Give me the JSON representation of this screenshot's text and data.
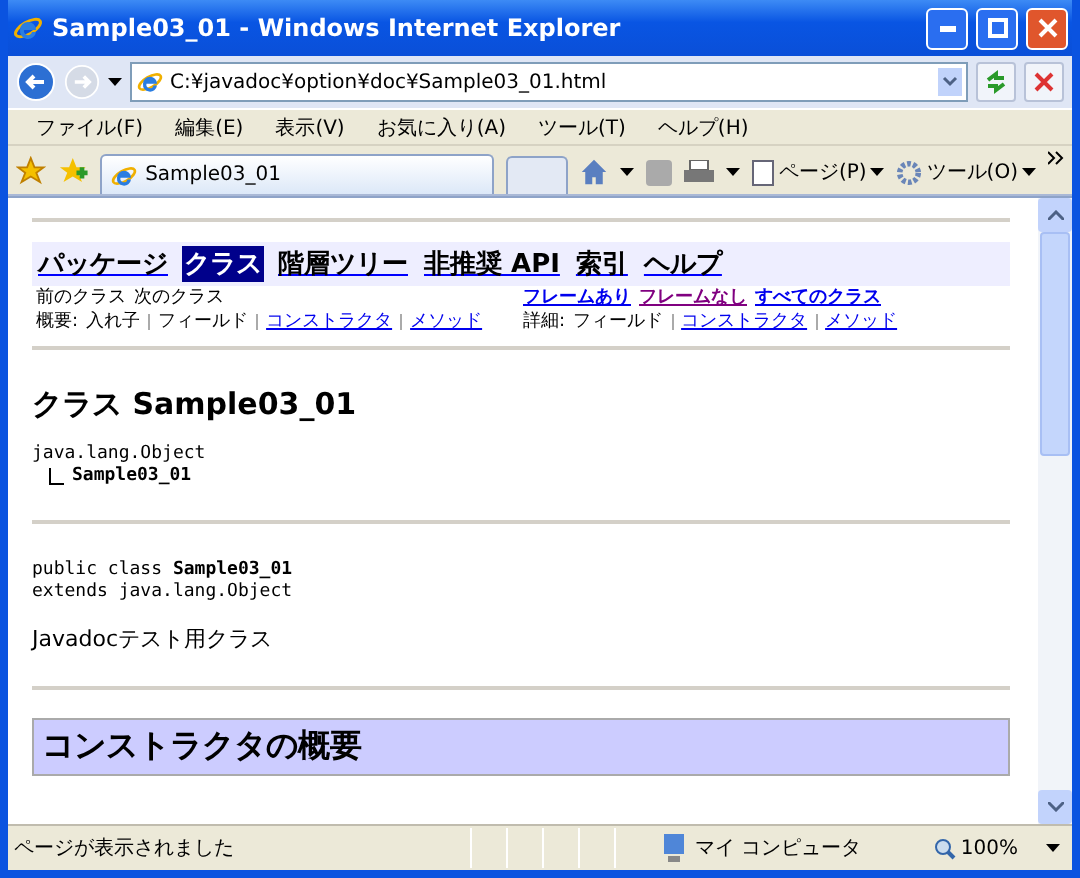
{
  "window": {
    "title": "Sample03_01 - Windows Internet Explorer"
  },
  "address_bar": {
    "value": "C:¥javadoc¥option¥doc¥Sample03_01.html"
  },
  "menu": [
    "ファイル(F)",
    "編集(E)",
    "表示(V)",
    "お気に入り(A)",
    "ツール(T)",
    "ヘルプ(H)"
  ],
  "tabs": [
    {
      "label": "Sample03_01",
      "selected": true
    }
  ],
  "command_bar": [
    "ページ(P)",
    "ツール(O)"
  ],
  "page": {
    "nav": [
      {
        "label": "パッケージ",
        "selected": false
      },
      {
        "label": "クラス",
        "selected": true
      },
      {
        "label": "階層ツリー",
        "selected": false
      },
      {
        "label": "非推奨 API",
        "selected": false
      },
      {
        "label": "索引",
        "selected": false
      },
      {
        "label": "ヘルプ",
        "selected": false
      }
    ],
    "prev_next": [
      "前のクラス",
      "次のクラス"
    ],
    "frame_links": [
      {
        "label": "フレームあり",
        "visited": false
      },
      {
        "label": "フレームなし",
        "visited": true
      },
      {
        "label": "すべてのクラス",
        "visited": false
      }
    ],
    "summary": {
      "label": "概要:",
      "items": [
        {
          "label": "入れ子",
          "link": false
        },
        {
          "label": "フィールド",
          "link": false
        },
        {
          "label": "コンストラクタ",
          "link": true
        },
        {
          "label": "メソッド",
          "link": true
        }
      ]
    },
    "detail": {
      "label": "詳細:",
      "items": [
        {
          "label": "フィールド",
          "link": false
        },
        {
          "label": "コンストラクタ",
          "link": true
        },
        {
          "label": "メソッド",
          "link": true
        }
      ]
    },
    "heading": "クラス Sample03_01",
    "hierarchy": {
      "parent": "java.lang.Object",
      "child": "Sample03_01"
    },
    "declaration": [
      "public class **Sample03_01**",
      "extends java.lang.Object"
    ],
    "description": "Javadocテスト用クラス",
    "section_title": "コンストラクタの概要"
  },
  "status_bar": {
    "text": "ページが表示されました",
    "zone": "マイ コンピュータ",
    "zoom": "100%"
  }
}
